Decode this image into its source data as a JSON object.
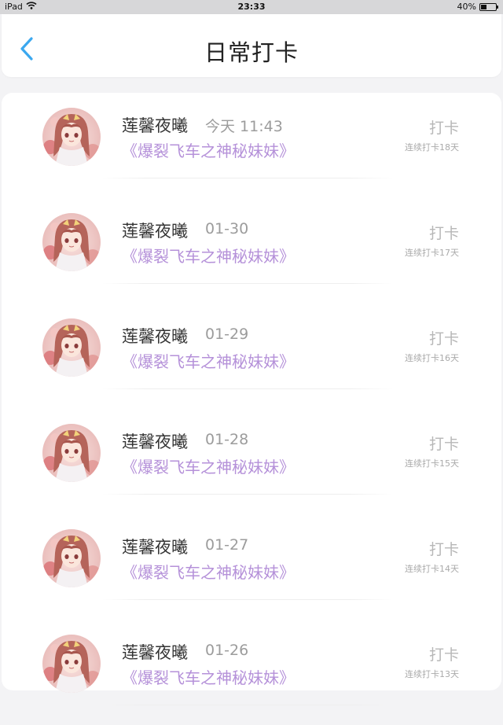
{
  "status_bar": {
    "device": "iPad",
    "time": "23:33",
    "battery": "40%",
    "battery_level": 0.4
  },
  "header": {
    "title": "日常打卡",
    "back_icon": "chevron-left-icon",
    "accent_color": "#3ba8ef"
  },
  "entries": [
    {
      "name": "莲馨夜曦",
      "time": "今天 11:43",
      "book": "《爆裂飞车之神秘妹妹》",
      "action": "打卡",
      "streak": "连续打卡18天"
    },
    {
      "name": "莲馨夜曦",
      "time": "01-30",
      "book": "《爆裂飞车之神秘妹妹》",
      "action": "打卡",
      "streak": "连续打卡17天"
    },
    {
      "name": "莲馨夜曦",
      "time": "01-29",
      "book": "《爆裂飞车之神秘妹妹》",
      "action": "打卡",
      "streak": "连续打卡16天"
    },
    {
      "name": "莲馨夜曦",
      "time": "01-28",
      "book": "《爆裂飞车之神秘妹妹》",
      "action": "打卡",
      "streak": "连续打卡15天"
    },
    {
      "name": "莲馨夜曦",
      "time": "01-27",
      "book": "《爆裂飞车之神秘妹妹》",
      "action": "打卡",
      "streak": "连续打卡14天"
    },
    {
      "name": "莲馨夜曦",
      "time": "01-26",
      "book": "《爆裂飞车之神秘妹妹》",
      "action": "打卡",
      "streak": "连续打卡13天"
    }
  ],
  "colors": {
    "book_title": "#b591d9",
    "muted": "#b7b7b7"
  }
}
